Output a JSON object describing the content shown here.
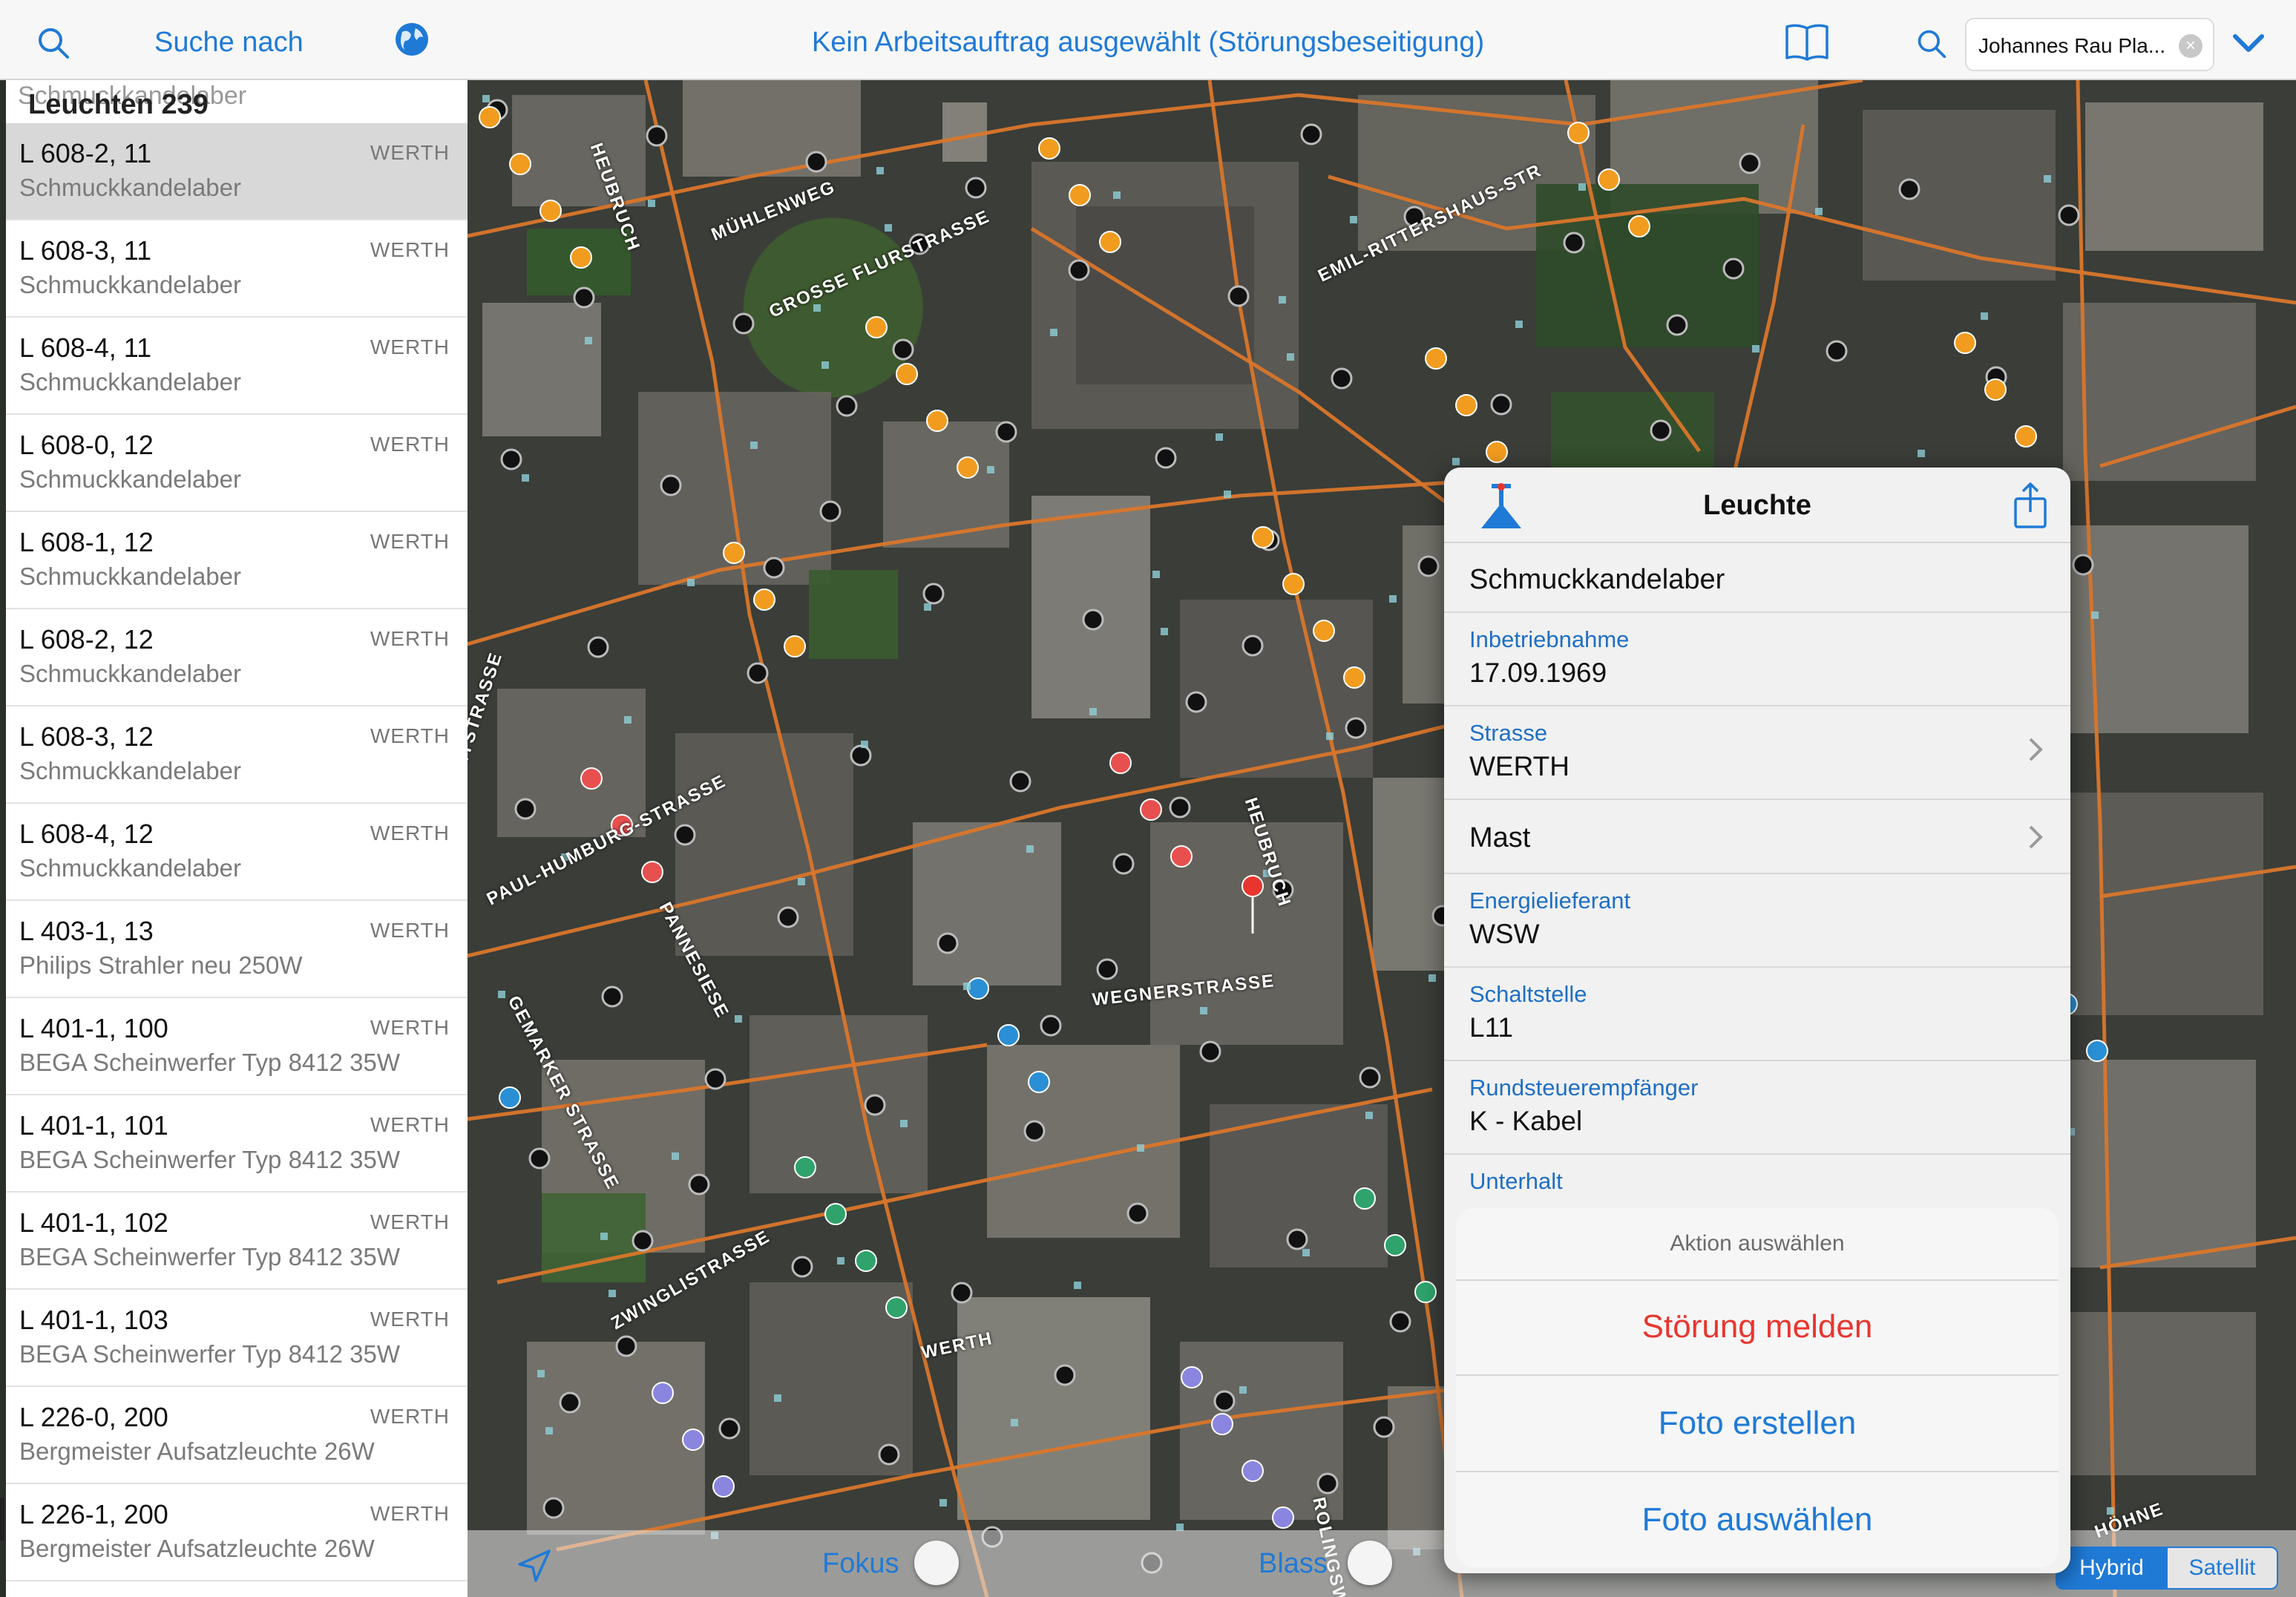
{
  "topbar": {
    "search_by_label": "Suche nach",
    "title": "Kein Arbeitsauftrag ausgewählt (Störungsbeseitigung)",
    "search_field_value": "Johannes Rau Pla...",
    "clear_glyph": "×"
  },
  "sidebar": {
    "header_ghost": "Schmuckkandelaber",
    "header_title": "Leuchten 239",
    "items": [
      {
        "name": "L 608-2, 11",
        "street": "WERTH",
        "type": "Schmuckkandelaber",
        "selected": true
      },
      {
        "name": "L 608-3, 11",
        "street": "WERTH",
        "type": "Schmuckkandelaber"
      },
      {
        "name": "L 608-4, 11",
        "street": "WERTH",
        "type": "Schmuckkandelaber"
      },
      {
        "name": "L 608-0, 12",
        "street": "WERTH",
        "type": "Schmuckkandelaber"
      },
      {
        "name": "L 608-1, 12",
        "street": "WERTH",
        "type": "Schmuckkandelaber"
      },
      {
        "name": "L 608-2, 12",
        "street": "WERTH",
        "type": "Schmuckkandelaber"
      },
      {
        "name": "L 608-3, 12",
        "street": "WERTH",
        "type": "Schmuckkandelaber"
      },
      {
        "name": "L 608-4, 12",
        "street": "WERTH",
        "type": "Schmuckkandelaber"
      },
      {
        "name": "L 403-1, 13",
        "street": "WERTH",
        "type": "Philips Strahler neu 250W"
      },
      {
        "name": "L 401-1, 100",
        "street": "WERTH",
        "type": "BEGA Scheinwerfer Typ 8412 35W"
      },
      {
        "name": "L 401-1, 101",
        "street": "WERTH",
        "type": "BEGA Scheinwerfer Typ 8412 35W"
      },
      {
        "name": "L 401-1, 102",
        "street": "WERTH",
        "type": "BEGA Scheinwerfer Typ 8412 35W"
      },
      {
        "name": "L 401-1, 103",
        "street": "WERTH",
        "type": "BEGA Scheinwerfer Typ 8412 35W"
      },
      {
        "name": "L 226-0, 200",
        "street": "WERTH",
        "type": "Bergmeister Aufsatzleuchte 26W"
      },
      {
        "name": "L 226-1, 200",
        "street": "WERTH",
        "type": "Bergmeister Aufsatzleuchte 26W"
      }
    ]
  },
  "map": {
    "streets": [
      "HEUBRUCH",
      "MÜHLENWEG",
      "GROSSE FLURSTRASSE",
      "EMIL-RITTERSHAUS-STR",
      "PAUL-HUMBURG-STRASSE",
      "PANNESIESE",
      "HEUBRUCH",
      "WEGNERSTRASSE",
      "GEMARKER STRASSE",
      "ZWINGLISTRASSE",
      "WERTH",
      "WERTH",
      "HÖHNE",
      "ENTSTRASSE",
      "ROLINGSWERTH"
    ]
  },
  "panel": {
    "title": "Leuchte",
    "type_value": "Schmuckkandelaber",
    "fields": {
      "inbetriebnahme_label": "Inbetriebnahme",
      "inbetriebnahme_value": "17.09.1969",
      "strasse_label": "Strasse",
      "strasse_value": "WERTH",
      "mast_label": "Mast",
      "energie_label": "Energielieferant",
      "energie_value": "WSW",
      "schaltstelle_label": "Schaltstelle",
      "schaltstelle_value": "L11",
      "rundsteuer_label": "Rundsteuerempfänger",
      "rundsteuer_value": "K - Kabel",
      "unterhalt_label": "Unterhalt"
    }
  },
  "action_sheet": {
    "title": "Aktion auswählen",
    "report": "Störung melden",
    "take_photo": "Foto erstellen",
    "choose_photo": "Foto auswählen"
  },
  "bottombar": {
    "fokus_label": "Fokus",
    "blass_label": "Blass",
    "map_types": [
      "Hybrid",
      "Satellit"
    ],
    "active_map_type": "Hybrid"
  },
  "colors": {
    "accent": "#1f7ad6",
    "danger": "#e8362f",
    "network_line": "#d9762b"
  }
}
